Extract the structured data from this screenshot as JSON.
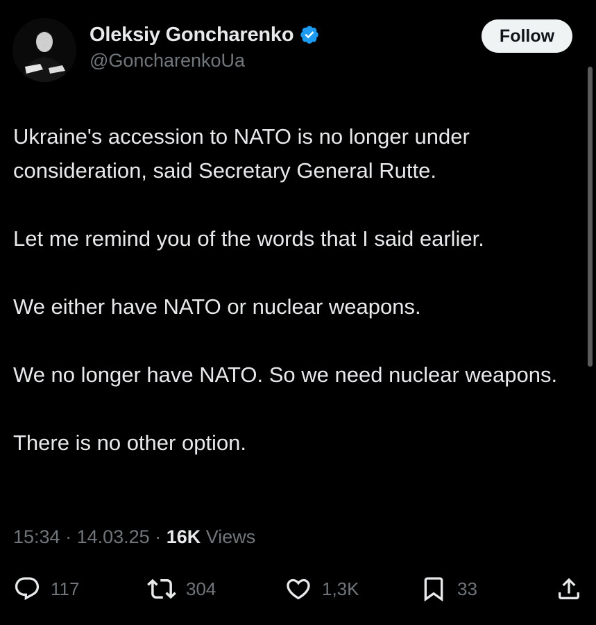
{
  "author": {
    "display_name": "Oleksiy Goncharenko",
    "handle": "@GoncharenkoUa",
    "verified": true,
    "verified_color": "#1d9bf0"
  },
  "follow_button": {
    "label": "Follow"
  },
  "tweet": {
    "paragraphs": [
      "Ukraine's accession to NATO is no longer under consideration, said Secretary General Rutte.",
      "Let me remind you of the words that I said earlier.",
      "We either have NATO or nuclear weapons.",
      "We no longer have NATO. So we need nuclear weapons.",
      "There is no other option."
    ]
  },
  "meta": {
    "time": "15:34",
    "separator": " · ",
    "date": "14.03.25",
    "views_count": "16K",
    "views_label": "Views"
  },
  "actions": {
    "reply": {
      "icon": "reply-icon",
      "count": "117"
    },
    "repost": {
      "icon": "repost-icon",
      "count": "304"
    },
    "like": {
      "icon": "heart-icon",
      "count": "1,3K"
    },
    "bookmark": {
      "icon": "bookmark-icon",
      "count": "33"
    },
    "share": {
      "icon": "share-icon"
    }
  },
  "colors": {
    "background": "#000000",
    "text_primary": "#e7e9ea",
    "text_secondary": "#71767b",
    "follow_bg": "#eff3f4"
  }
}
